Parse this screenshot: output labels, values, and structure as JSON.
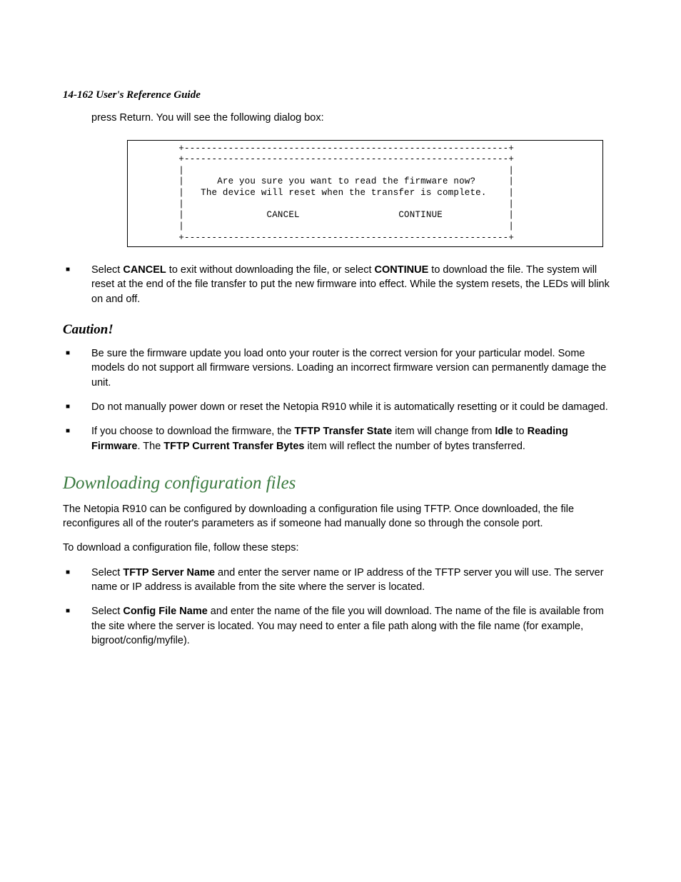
{
  "header": "14-162  User's Reference Guide",
  "intro_line": "press Return. You will see the following dialog box:",
  "dialog": {
    "border_top": "         +-----------------------------------------------------------+",
    "border_top2": "         +-----------------------------------------------------------+",
    "blank": "         |                                                           |",
    "line1": "         |      Are you sure you want to read the firmware now?      |",
    "line2": "         |   The device will reset when the transfer is complete.    |",
    "blank2": "         |                                                           |",
    "buttons": "         |               CANCEL                  CONTINUE            |",
    "blank3": "         |                                                           |",
    "border_bot": "         +-----------------------------------------------------------+"
  },
  "bullets1": {
    "b0": {
      "p1": "Select ",
      "bold1": "CANCEL",
      "p2": " to exit without downloading the file, or select ",
      "bold2": "CONTINUE",
      "p3": " to download the file. The system will reset at the end of the file transfer to put the new firmware into effect. While the system resets, the LEDs will blink on and off."
    }
  },
  "caution_heading": "Caution!",
  "caution_bullets": {
    "b0": "Be sure the firmware update you load onto your router is the correct version for your particular model. Some models do not support all firmware versions. Loading an incorrect firmware version can permanently damage the unit.",
    "b1": "Do not manually power down or reset the Netopia R910 while it is automatically resetting or it could be damaged.",
    "b2": {
      "p1": "If you choose to download the firmware, the ",
      "bold1": "TFTP Transfer State",
      "p2": " item will change from ",
      "bold2": "Idle",
      "p3": " to ",
      "bold3": "Reading Firmware",
      "p4": ". The ",
      "bold4": "TFTP Current Transfer Bytes",
      "p5": " item will reflect the number of bytes transferred."
    }
  },
  "section_title": "Downloading configuration files",
  "para1": "The Netopia R910 can be configured by downloading a configuration file using TFTP. Once downloaded, the file reconfigures all of the router's parameters as if someone had manually done so through the console port.",
  "para2": "To download a configuration file, follow these steps:",
  "steps": {
    "s0": {
      "p1": "Select ",
      "bold1": "TFTP Server Name",
      "p2": " and enter the server name or IP address of the TFTP server you will use. The server name or IP address is available from the site where the server is located."
    },
    "s1": {
      "p1": "Select ",
      "bold1": "Config File Name",
      "p2": " and enter the name of the file you will download. The name of the file is available from the site where the server is located. You may need to enter a file path along with the file name (for example, bigroot/config/myfile)."
    }
  }
}
